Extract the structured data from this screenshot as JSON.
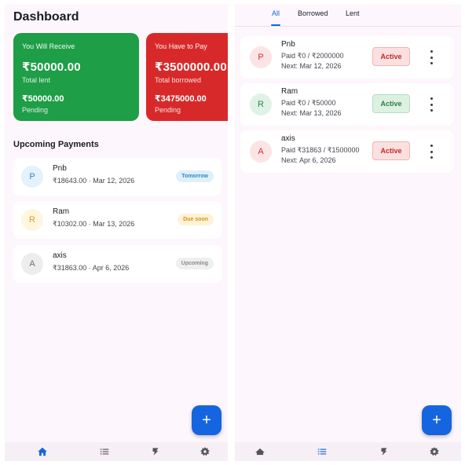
{
  "dashboard": {
    "title": "Dashboard",
    "receive": {
      "title": "You Will Receive",
      "amount": "₹50000.00",
      "amount_label": "Total lent",
      "pending_amount": "₹50000.00",
      "pending_label": "Pending"
    },
    "pay": {
      "title": "You Have to Pay",
      "amount": "₹3500000.00",
      "amount_label": "Total borrowed",
      "pending_amount": "₹3475000.00",
      "pending_label": "Pending"
    },
    "upcoming_title": "Upcoming Payments",
    "upcoming": [
      {
        "initial": "P",
        "name": "Pnb",
        "detail": "₹18643.00 · Mar 12, 2026",
        "status": "Tomorrow"
      },
      {
        "initial": "R",
        "name": "Ram",
        "detail": "₹10302.00 · Mar 13, 2026",
        "status": "Due soon"
      },
      {
        "initial": "A",
        "name": "axis",
        "detail": "₹31863.00 · Apr 6, 2026",
        "status": "Upcoming"
      }
    ],
    "fab_label": "+"
  },
  "loans": {
    "tabs": [
      "All",
      "Borrowed",
      "Lent"
    ],
    "active_tab": "All",
    "items": [
      {
        "initial": "P",
        "name": "Pnb",
        "paid": "Paid ₹0 / ₹2000000",
        "next": "Next: Mar 12, 2026",
        "status": "Active",
        "type": "borrowed"
      },
      {
        "initial": "R",
        "name": "Ram",
        "paid": "Paid ₹0 / ₹50000",
        "next": "Next: Mar 13, 2026",
        "status": "Active",
        "type": "lent"
      },
      {
        "initial": "A",
        "name": "axis",
        "paid": "Paid ₹31863 / ₹1500000",
        "next": "Next: Apr 6, 2026",
        "status": "Active",
        "type": "borrowed"
      }
    ],
    "fab_label": "+"
  },
  "nav": {
    "left": [
      "home-icon",
      "list-icon",
      "wallet-icon",
      "settings-icon"
    ],
    "right": [
      "home-icon",
      "list-icon",
      "wallet-icon",
      "settings-icon"
    ]
  },
  "colors": {
    "primary": "#1565e0",
    "receive": "#1e9e46",
    "pay": "#d8292a",
    "background": "#fdf7fd"
  }
}
